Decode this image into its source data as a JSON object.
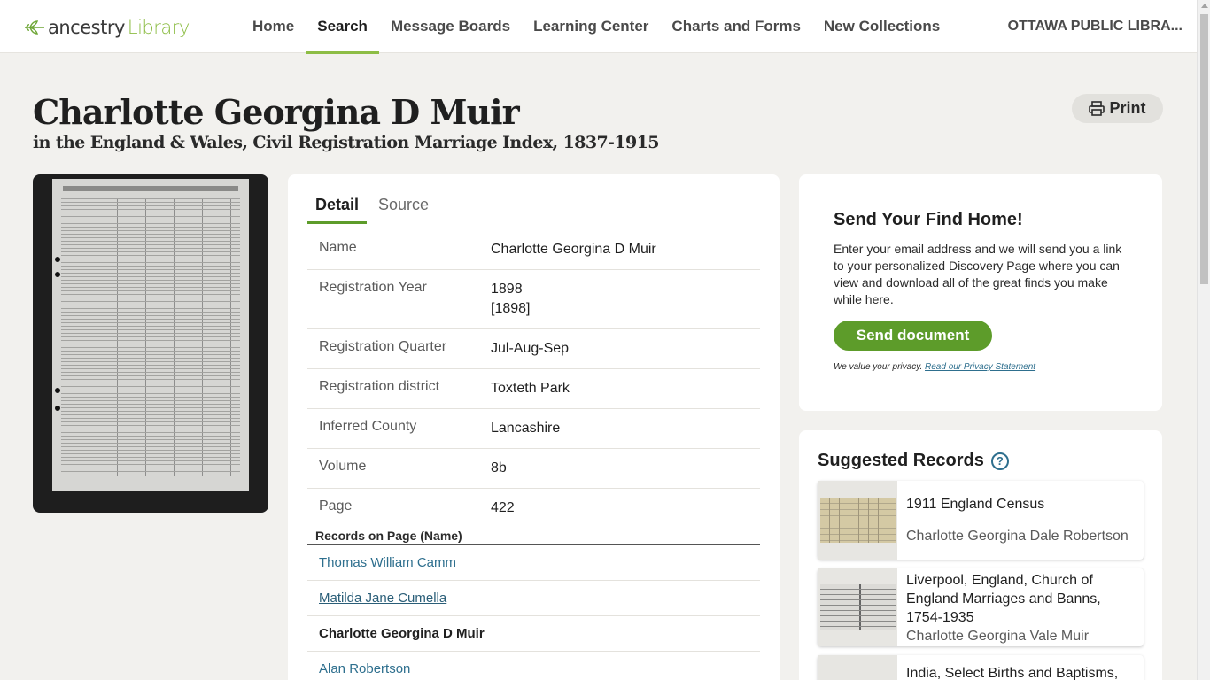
{
  "nav": {
    "logo_word": "ancestry",
    "logo_suffix": "Library",
    "links": [
      "Home",
      "Search",
      "Message Boards",
      "Learning Center",
      "Charts and Forms",
      "New Collections"
    ],
    "active": "Search",
    "org": "OTTAWA PUBLIC LIBRA..."
  },
  "record": {
    "name": "Charlotte Georgina D Muir",
    "collection": "in the England & Wales, Civil Registration Marriage Index, 1837-1915",
    "print_label": "Print"
  },
  "tabs": [
    "Detail",
    "Source"
  ],
  "facts": [
    {
      "label": "Name",
      "value": "Charlotte Georgina D Muir"
    },
    {
      "label": "Registration Year",
      "value": "1898",
      "value2": "[1898]"
    },
    {
      "label": "Registration Quarter",
      "value": "Jul-Aug-Sep"
    },
    {
      "label": "Registration district",
      "value": "Toxteth Park"
    },
    {
      "label": "Inferred County",
      "value": "Lancashire"
    },
    {
      "label": "Volume",
      "value": "8b"
    },
    {
      "label": "Page",
      "value": "422"
    }
  ],
  "records_on_page": {
    "heading": "Records on Page (Name)",
    "items": [
      "Thomas William Camm",
      "Matilda Jane Cumella",
      "Charlotte Georgina D Muir",
      "Alan Robertson"
    ]
  },
  "send": {
    "title": "Send Your Find Home!",
    "body": "Enter your email address and we will send you a link to your personalized Discovery Page where you can view and download all of the great finds you make while here.",
    "button": "Send document",
    "privacy_text": "We value your privacy.",
    "privacy_link": "Read our Privacy Statement"
  },
  "suggested": {
    "title": "Suggested Records",
    "items": [
      {
        "collection": "1911 England Census",
        "person": "Charlotte Georgina Dale Robertson"
      },
      {
        "collection": "Liverpool, England, Church of England Marriages and Banns, 1754-1935",
        "person": "Charlotte Georgina Vale Muir"
      },
      {
        "collection": "India, Select Births and Baptisms,",
        "person": ""
      }
    ]
  },
  "colors": {
    "accent_green": "#5d9c2a",
    "link_blue": "#2e6f8e",
    "background": "#f2f1ee"
  }
}
